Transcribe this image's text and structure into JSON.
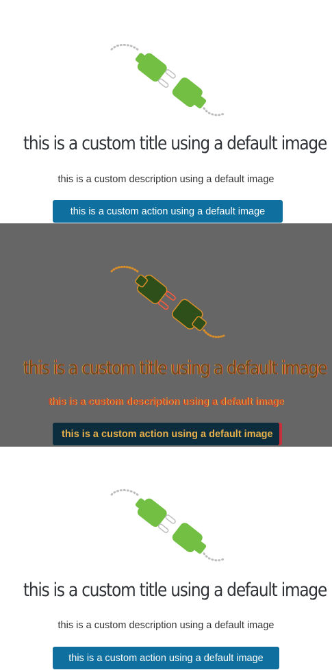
{
  "states": [
    {
      "title": "this is a custom title using a default image",
      "description": "this is a custom description using a default image",
      "action_label": "this is a custom action using a default image",
      "icon": "plug-disconnected-icon"
    },
    {
      "title": "this is a custom title using a default image",
      "description": "this is a custom description using a default image",
      "action_label": "this is a custom action using a default image",
      "icon": "plug-disconnected-icon"
    },
    {
      "title": "this is a custom title using a default image",
      "description": "this is a custom description using a default image",
      "action_label": "this is a custom action using a default image",
      "icon": "plug-disconnected-icon"
    }
  ],
  "colors": {
    "plug_green": "#73bf44",
    "button_blue": "#0f6f9e",
    "dim_overlay": "#666666",
    "dim_plug": "#2f4f1a",
    "highlight_orange": "#d98e2a"
  }
}
